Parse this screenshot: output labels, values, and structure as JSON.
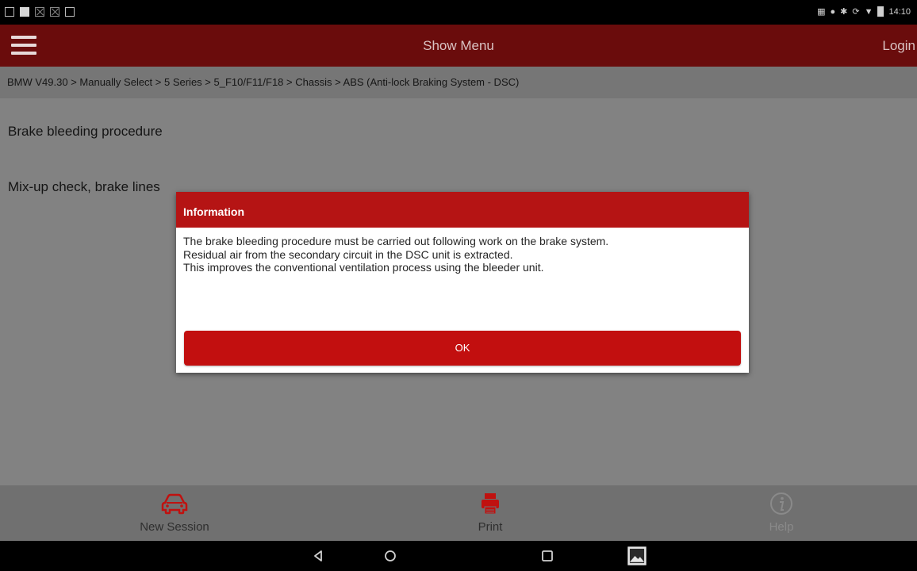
{
  "status_bar": {
    "left_icons": [
      "screen-cast-icon",
      "notification-icon",
      "x-box-icon",
      "x-box-icon",
      "menu-box-icon"
    ],
    "time": "14:10",
    "right_icons": [
      "mobile-data-icon",
      "location-icon",
      "bluetooth-icon",
      "sync-icon",
      "wifi-icon",
      "battery-icon"
    ]
  },
  "app_bar": {
    "title": "Show Menu",
    "login_label": "Login"
  },
  "breadcrumb": "BMW V49.30 > Manually Select > 5 Series > 5_F10/F11/F18 > Chassis > ABS (Anti-lock Braking System - DSC)",
  "menu_items": [
    {
      "label": "Brake bleeding procedure"
    },
    {
      "label": "Mix-up check, brake lines"
    }
  ],
  "dialog": {
    "title": "Information",
    "lines": [
      "The brake bleeding procedure must be carried out following work on the brake system.",
      "Residual air from the secondary circuit in the DSC unit is extracted.",
      "This improves the conventional ventilation process using the bleeder unit."
    ],
    "ok_label": "OK"
  },
  "toolbar": {
    "new_session_label": "New Session",
    "print_label": "Print",
    "help_label": "Help"
  },
  "colors": {
    "app_bar": "#6a0c0c",
    "dialog_header": "#b51414",
    "ok_button": "#c20f0f",
    "icon_red": "#c0110f"
  }
}
